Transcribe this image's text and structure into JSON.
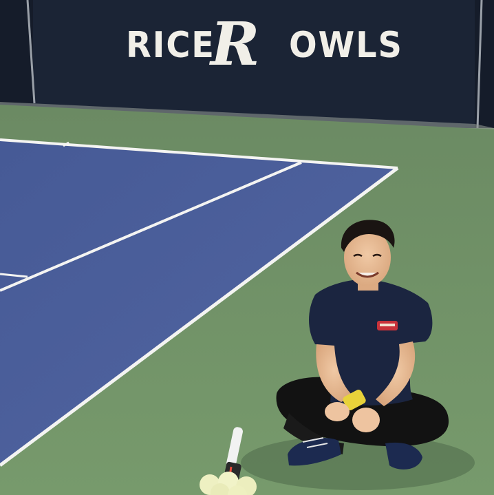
{
  "photo": {
    "subject": "tennis-player-sitting-on-court",
    "banner": {
      "left_text": "RICE",
      "center_mark": "R",
      "right_text": "OWLS"
    },
    "colors": {
      "court_blue": "#4b5f9c",
      "court_green": "#6f8d66",
      "banner_navy": "#1c2537",
      "lines": "#f4f4f2",
      "shirt": "#1b2540",
      "sweatband": "#e8d23a"
    }
  }
}
